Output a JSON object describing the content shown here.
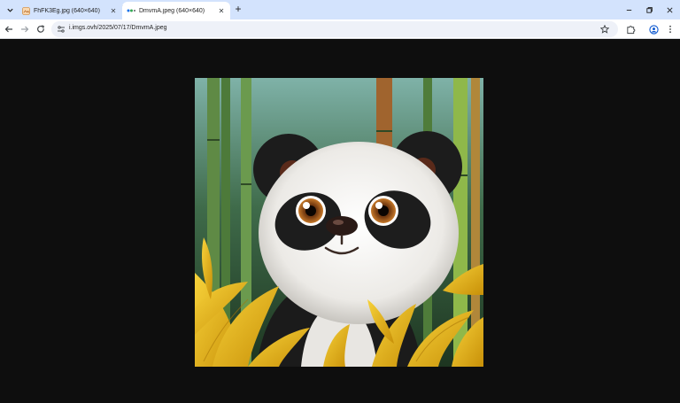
{
  "tabs": [
    {
      "title": "FhFK3Eg.jpg (640×640)",
      "active": false
    },
    {
      "title": "DmvmA.jpeg (640×640)",
      "active": true
    }
  ],
  "address_bar": {
    "url": "i.imgs.ovh/2025/07/17/DmvmA.jpeg"
  },
  "image": {
    "alt": "DmvmA.jpeg",
    "description_icon": "panda-in-bamboo-image"
  },
  "colors": {
    "tabstrip": "#d3e3fd",
    "viewport": "#0e0e0e",
    "accent": "#0b57d0"
  }
}
